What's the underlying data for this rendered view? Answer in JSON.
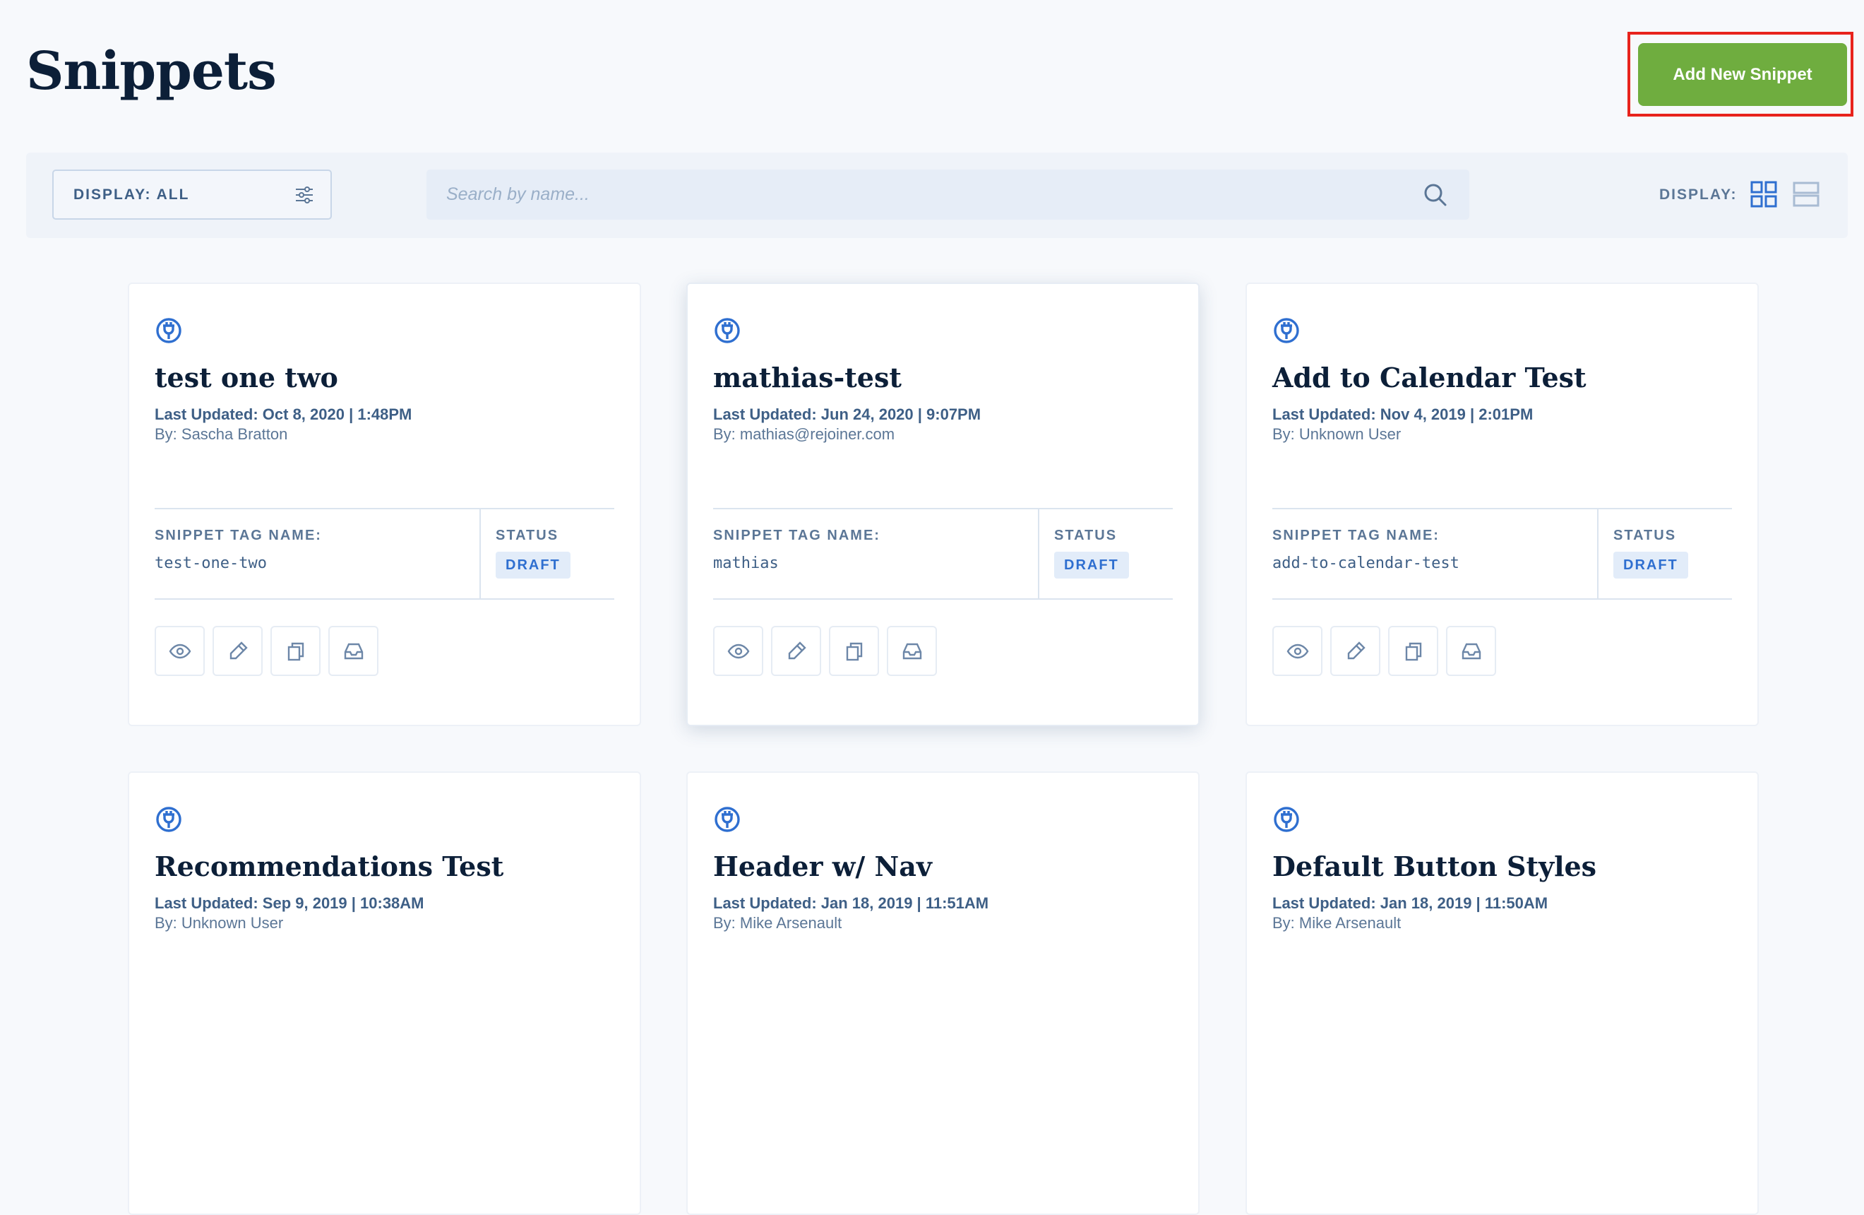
{
  "page": {
    "title": "Snippets"
  },
  "header": {
    "add_button_label": "Add New Snippet"
  },
  "toolbar": {
    "filter_label": "DISPLAY: ALL",
    "search_placeholder": "Search by name...",
    "display_label": "DISPLAY:",
    "view_mode": "grid"
  },
  "colors": {
    "accent_green": "#6fad3f",
    "accent_blue": "#2f6fd0",
    "highlight_red": "#e8231c"
  },
  "card_labels": {
    "tag_name": "SNIPPET TAG NAME:",
    "status": "STATUS"
  },
  "snippets": [
    {
      "title": "test one two",
      "updated": "Last Updated: Oct 8, 2020 | 1:48PM",
      "by": "By: Sascha Bratton",
      "tag": "test-one-two",
      "status": "DRAFT"
    },
    {
      "title": "mathias-test",
      "updated": "Last Updated: Jun 24, 2020 | 9:07PM",
      "by": "By: mathias@rejoiner.com",
      "tag": "mathias",
      "status": "DRAFT"
    },
    {
      "title": "Add to Calendar Test",
      "updated": "Last Updated: Nov 4, 2019 | 2:01PM",
      "by": "By: Unknown User",
      "tag": "add-to-calendar-test",
      "status": "DRAFT"
    },
    {
      "title": "Recommendations Test",
      "updated": "Last Updated: Sep 9, 2019 | 10:38AM",
      "by": "By: Unknown User"
    },
    {
      "title": "Header w/ Nav",
      "updated": "Last Updated: Jan 18, 2019 | 11:51AM",
      "by": "By: Mike Arsenault"
    },
    {
      "title": "Default Button Styles",
      "updated": "Last Updated: Jan 18, 2019 | 11:50AM",
      "by": "By: Mike Arsenault"
    }
  ]
}
